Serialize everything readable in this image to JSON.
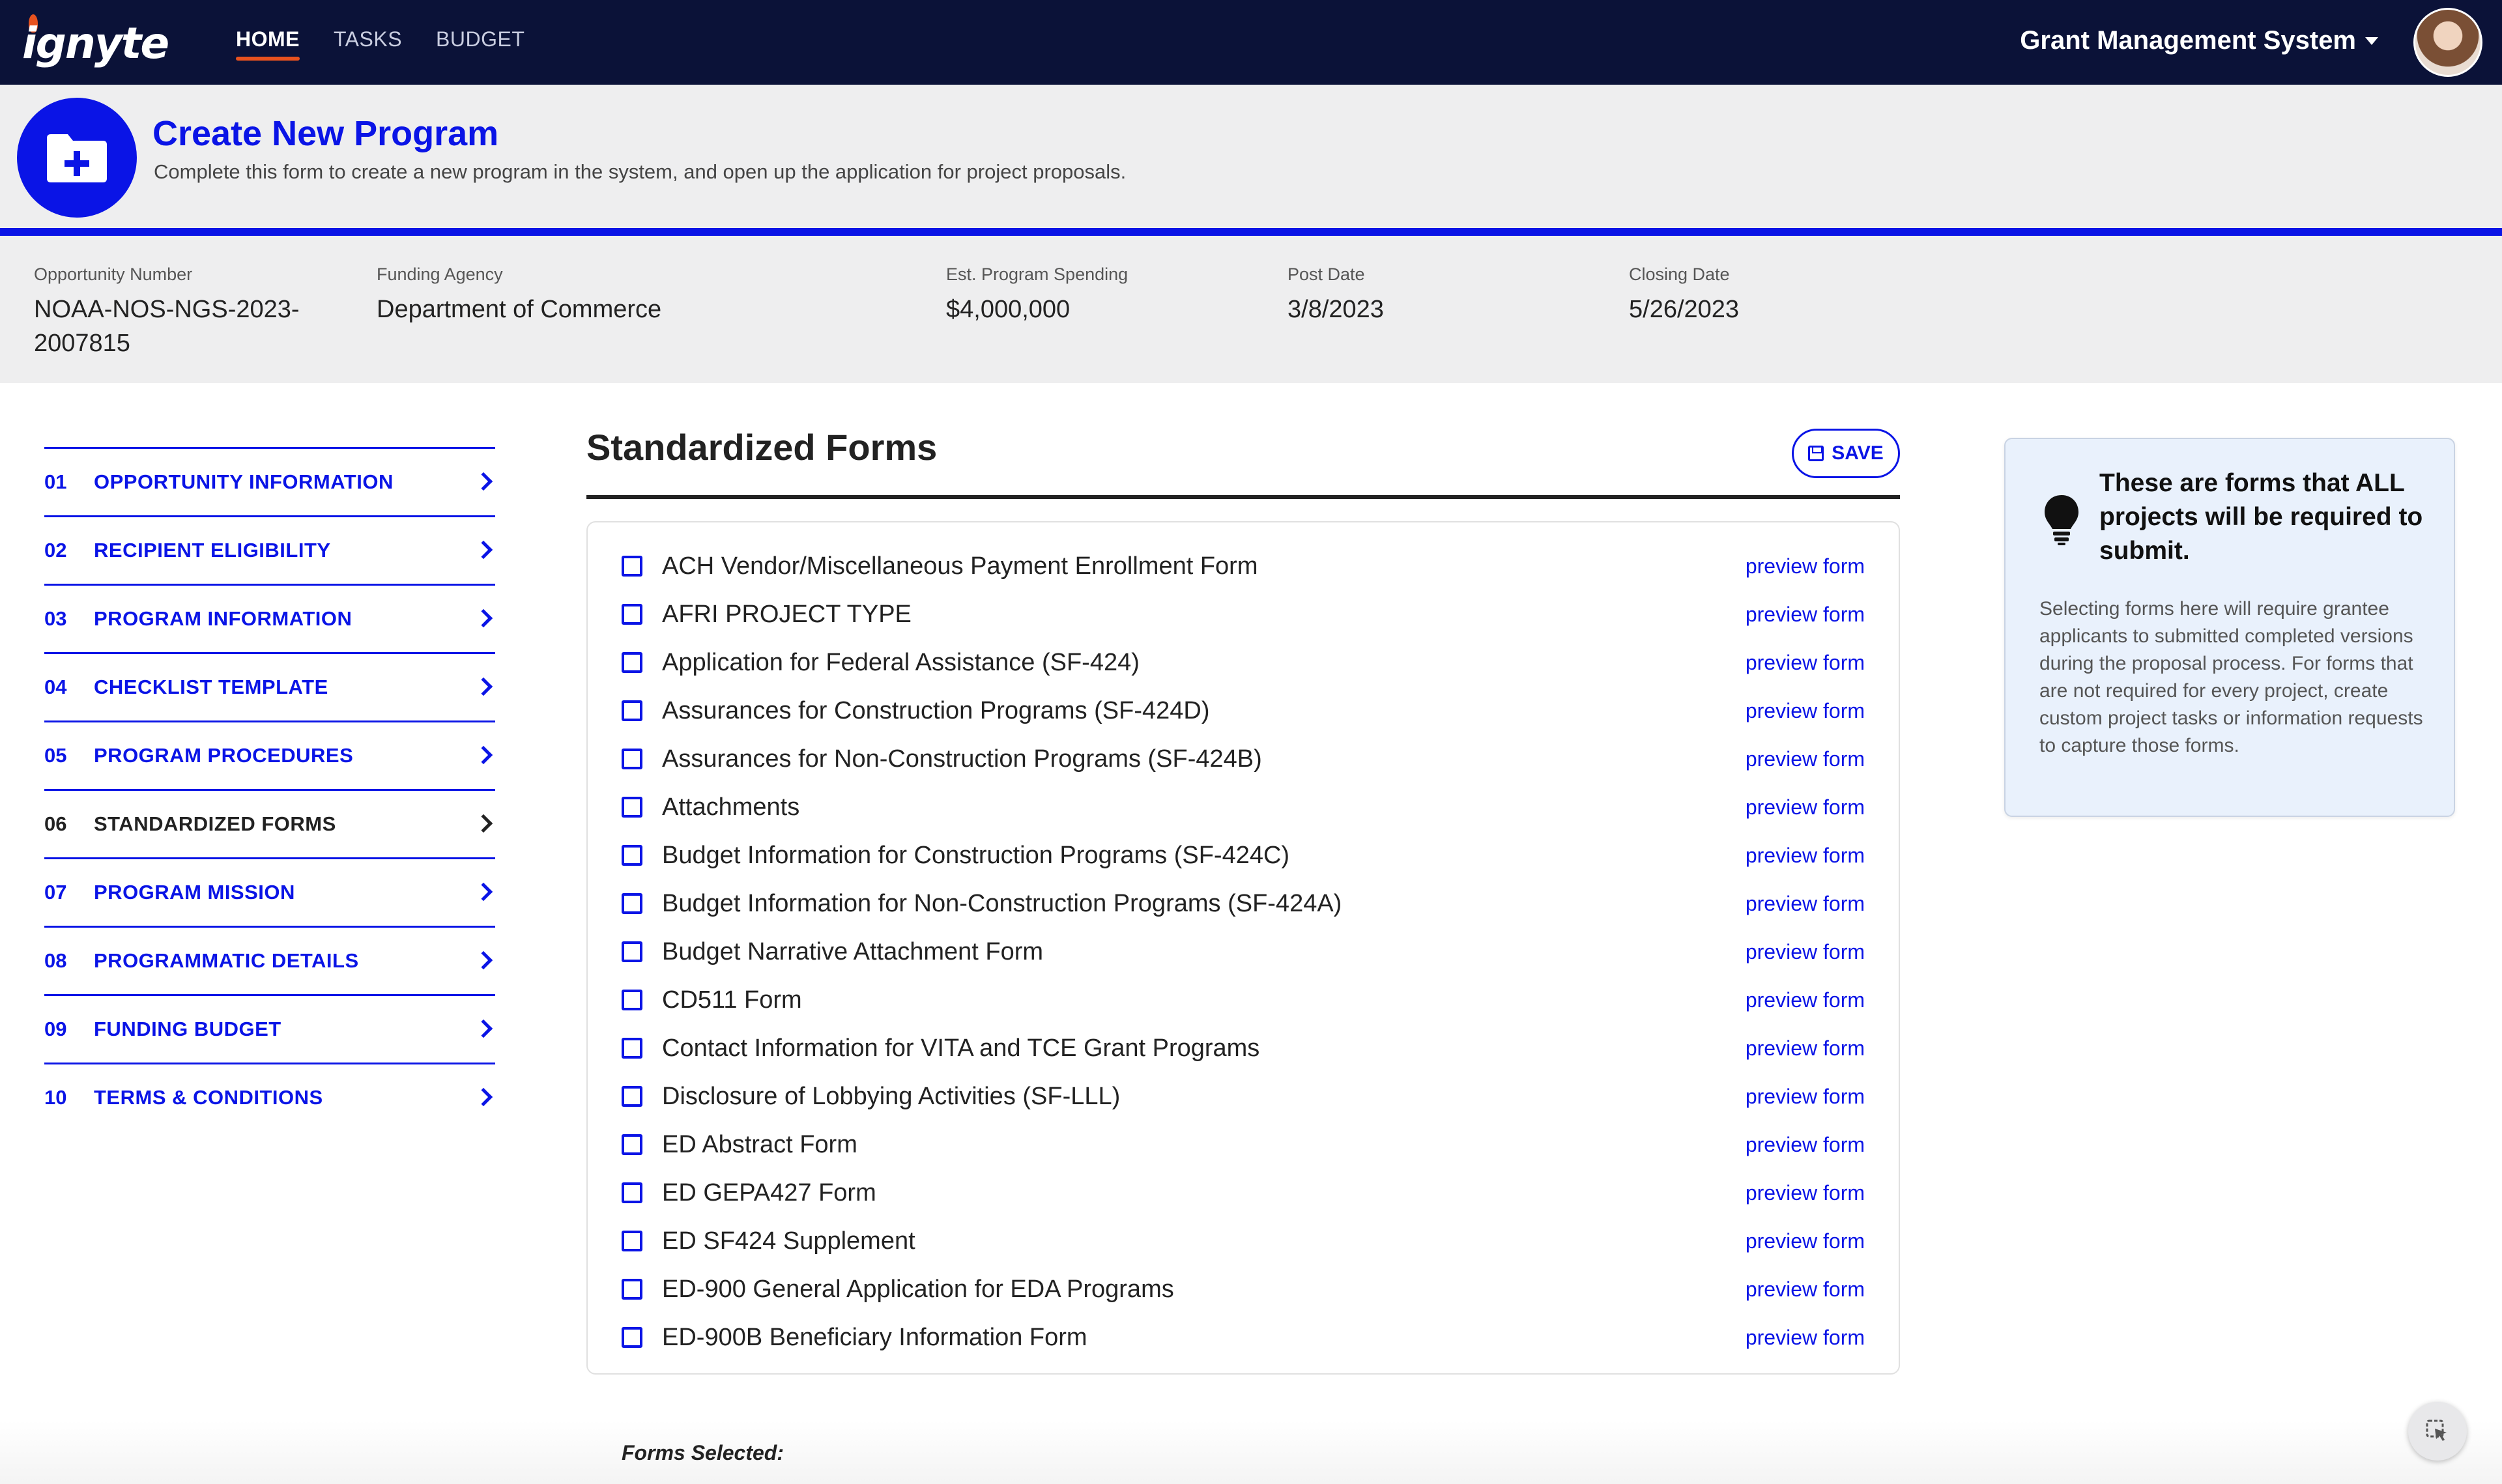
{
  "nav": {
    "logo_text": "ignyte",
    "items": [
      {
        "label": "HOME",
        "active": true
      },
      {
        "label": "TASKS",
        "active": false
      },
      {
        "label": "BUDGET",
        "active": false
      }
    ],
    "system_label": "Grant Management System"
  },
  "header": {
    "title": "Create New Program",
    "subtitle": "Complete this form to create a new program in the system, and open up the application for project proposals.",
    "icon": "folder-plus-icon"
  },
  "summary": {
    "opportunity_label": "Opportunity Number",
    "opportunity_value_line1": "NOAA-NOS-NGS-2023-",
    "opportunity_value_line2": "2007815",
    "agency_label": "Funding Agency",
    "agency_value": "Department of Commerce",
    "spending_label": "Est. Program Spending",
    "spending_value": "$4,000,000",
    "post_label": "Post Date",
    "post_value": "3/8/2023",
    "closing_label": "Closing Date",
    "closing_value": "5/26/2023"
  },
  "steps": [
    {
      "num": "01",
      "label": "OPPORTUNITY INFORMATION"
    },
    {
      "num": "02",
      "label": "RECIPIENT ELIGIBILITY"
    },
    {
      "num": "03",
      "label": "PROGRAM INFORMATION"
    },
    {
      "num": "04",
      "label": "CHECKLIST TEMPLATE"
    },
    {
      "num": "05",
      "label": "PROGRAM PROCEDURES"
    },
    {
      "num": "06",
      "label": "STANDARDIZED FORMS"
    },
    {
      "num": "07",
      "label": "PROGRAM MISSION"
    },
    {
      "num": "08",
      "label": "PROGRAMMATIC DETAILS"
    },
    {
      "num": "09",
      "label": "FUNDING BUDGET"
    },
    {
      "num": "10",
      "label": "TERMS & CONDITIONS"
    }
  ],
  "main": {
    "section_title": "Standardized Forms",
    "save_label": "SAVE",
    "preview_label": "preview form",
    "forms": [
      "ACH Vendor/Miscellaneous Payment Enrollment Form",
      "AFRI PROJECT TYPE",
      "Application for Federal Assistance (SF-424)",
      "Assurances for Construction Programs (SF-424D)",
      "Assurances for Non-Construction Programs (SF-424B)",
      "Attachments",
      "Budget Information for Construction Programs (SF-424C)",
      "Budget Information for Non-Construction Programs (SF-424A)",
      "Budget Narrative Attachment Form",
      "CD511 Form",
      "Contact Information for VITA and TCE Grant Programs",
      "Disclosure of Lobbying Activities (SF-LLL)",
      "ED Abstract Form",
      "ED GEPA427 Form",
      "ED SF424 Supplement",
      "ED-900 General Application for EDA Programs",
      "ED-900B Beneficiary Information Form"
    ],
    "forms_selected_label": "Forms Selected:"
  },
  "info": {
    "heading": "These are forms that ALL projects will be required to submit.",
    "body": "Selecting forms here will require grantee applicants to submitted completed versions during the proposal process. For forms that are not required for every project, create custom project tasks or information requests to capture those forms."
  },
  "colors": {
    "navy": "#0b1238",
    "accent": "#0a14e6",
    "nav_underline": "#e8521f",
    "band": "#eeeeef"
  }
}
